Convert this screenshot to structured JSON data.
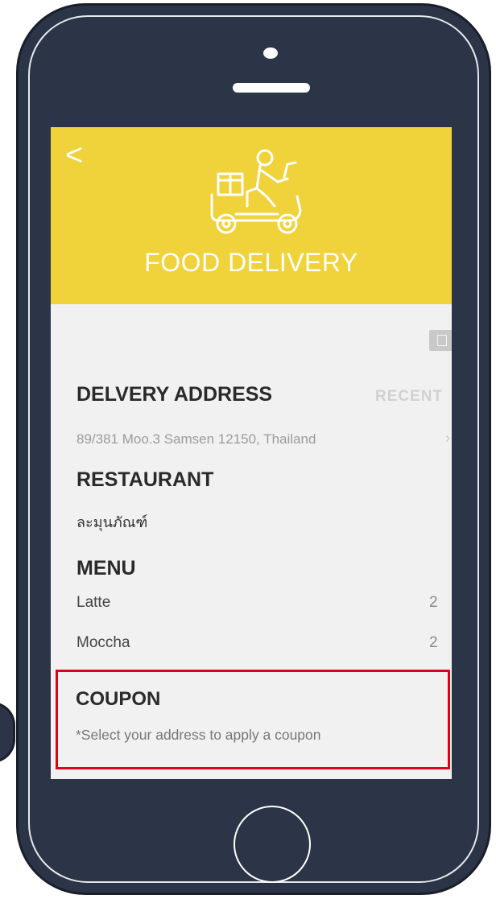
{
  "header": {
    "back_symbol": "<",
    "title": "FOOD DELIVERY",
    "logo_icon": "delivery-scooter-icon",
    "background_color": "#f0d23a"
  },
  "delivery": {
    "title": "DELVERY ADDRESS",
    "recent_label": "RECENT",
    "address": "89/381 Moo.3 Samsen 12150, Thailand"
  },
  "restaurant": {
    "title": "RESTAURANT",
    "name": "ละมุนภัณฑ์"
  },
  "menu": {
    "title": "MENU",
    "items": [
      {
        "name": "Latte",
        "qty": "2"
      },
      {
        "name": "Moccha",
        "qty": "2"
      }
    ]
  },
  "coupon": {
    "title": "COUPON",
    "note": "*Select your address to apply a coupon",
    "highlight_color": "#e0001c"
  },
  "device": {
    "body_color": "#2c3547"
  }
}
